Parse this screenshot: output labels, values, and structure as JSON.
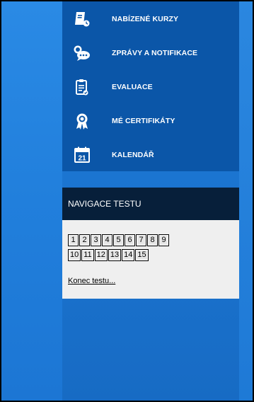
{
  "menu": {
    "items": [
      {
        "label": "NABÍZENÉ KURZY",
        "icon": "course-book-icon"
      },
      {
        "label": "ZPRÁVY A NOTIFIKACE",
        "icon": "chat-bubble-icon"
      },
      {
        "label": "EVALUACE",
        "icon": "clipboard-icon"
      },
      {
        "label": "MÉ CERTIFIKÁTY",
        "icon": "certificate-ribbon-icon"
      },
      {
        "label": "KALENDÁŘ",
        "icon": "calendar-icon",
        "icon_text": "21"
      }
    ]
  },
  "test_nav": {
    "title": "NAVIGACE TESTU",
    "numbers_row1": [
      "1",
      "2",
      "3",
      "4",
      "5",
      "6",
      "7",
      "8",
      "9"
    ],
    "numbers_row2": [
      "10",
      "11",
      "12",
      "13",
      "14",
      "15"
    ],
    "end_link": "Konec testu..."
  },
  "colors": {
    "menu_bg": "#0b56a8",
    "nav_header_bg": "#071f3a",
    "page_bg": "#1a73cf"
  }
}
